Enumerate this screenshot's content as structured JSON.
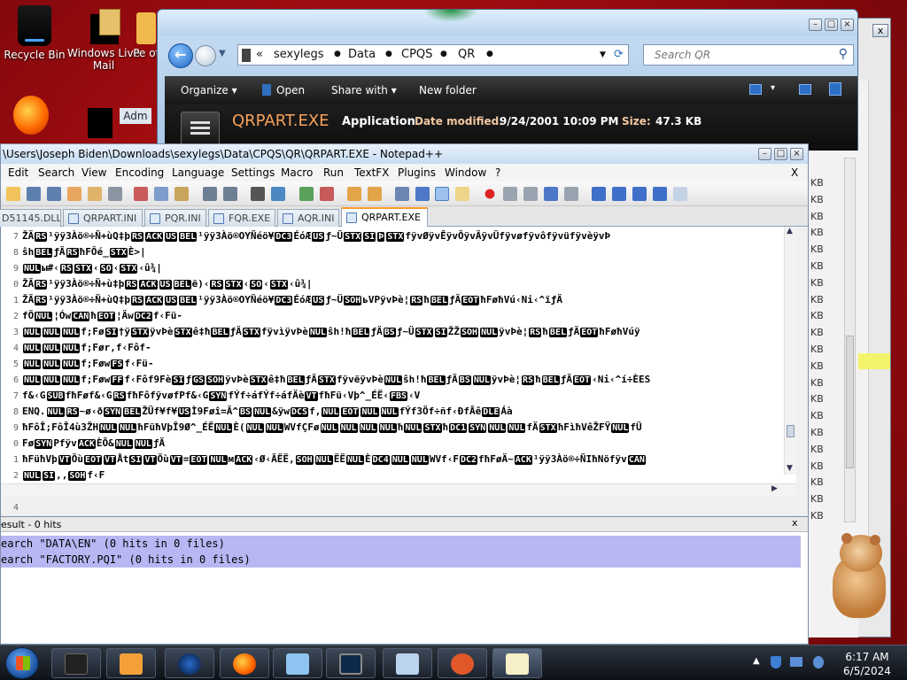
{
  "desktop": {
    "icons": [
      {
        "label": "Recycle Bin"
      },
      {
        "label": "Windows Live Mail"
      },
      {
        "label": "Pe of"
      },
      {
        "label": "Adm"
      }
    ]
  },
  "explorer": {
    "address": {
      "segments": [
        "sexylegs",
        "Data",
        "CPQS",
        "QR"
      ],
      "prefix": "«"
    },
    "search": {
      "placeholder": "Search QR"
    },
    "toolbar": {
      "organize": "Organize",
      "open": "Open",
      "share": "Share with",
      "new_folder": "New folder"
    },
    "details": {
      "filename": "QRPART.EXE",
      "type": "Application",
      "modified_label": "Date modified:",
      "modified_value": "9/24/2001 10:09 PM",
      "size_label": "Size:",
      "size_value": "47.3 KB"
    },
    "side_sizes": [
      "KB",
      "KB",
      "KB",
      "KB",
      "KB",
      "KB",
      "KB",
      "KB",
      "KB",
      "KB",
      "KB",
      "KB",
      "KB",
      "KB",
      "KB",
      "KB",
      "KB",
      "KB",
      "KB",
      "KB",
      "KB"
    ]
  },
  "npp": {
    "title": "\\Users\\Joseph Biden\\Downloads\\sexylegs\\Data\\CPQS\\QR\\QRPART.EXE - Notepad++",
    "close": "X",
    "menu": [
      "Edit",
      "Search",
      "View",
      "Encoding",
      "Language",
      "Settings",
      "Macro",
      "Run",
      "TextFX",
      "Plugins",
      "Window",
      "?"
    ],
    "tabs": [
      {
        "label": "D51145.DLL",
        "active": false
      },
      {
        "label": "QRPART.INI",
        "active": false
      },
      {
        "label": "PQR.INI",
        "active": false
      },
      {
        "label": "FQR.EXE",
        "active": false
      },
      {
        "label": "AQR.INI",
        "active": false
      },
      {
        "label": "QRPART.EXE",
        "active": true
      }
    ],
    "line_numbers": [
      "7",
      "8",
      "9",
      "0",
      "1",
      "2",
      "3",
      "4",
      "5",
      "6",
      "7",
      "8",
      "9",
      "0",
      "1",
      "2",
      "3",
      "4",
      "5"
    ],
    "lines": [
      [
        "ŽÄ",
        "RS",
        "¹ÿÿ3Àö®÷Ñ+ùQ‡þ",
        "RS",
        "ACK",
        "US",
        "BEL",
        "¹ÿÿ3Àö®OYÑéö¥",
        "DC3",
        "ÉóÆ",
        "US",
        "ƒ~Ü",
        "STX",
        "SI",
        "Þ",
        "STX",
        "fÿvØÿvÊÿvÖÿvÄÿvÜfÿvøfÿvôfÿvüfÿvèÿvÞ"
      ],
      [
        "ŝh",
        "BEL",
        "ƒÄ",
        "RS",
        "ħFÔé_",
        "STX",
        "È>|"
      ],
      [
        "NUL",
        "ы#‹",
        "RS",
        "STX",
        "‹",
        "SO",
        "‹",
        "STX",
        "‹û¾|"
      ],
      [
        "ŽÄ",
        "RS",
        "¹ÿÿ3Àö®÷Ñ+ù‡þ",
        "RS",
        "ACK",
        "US",
        "BEL",
        "ë)‹",
        "RS",
        "STX",
        "‹",
        "SO",
        "‹",
        "STX",
        "‹û¾|"
      ],
      [
        "ŽÄ",
        "RS",
        "¹ÿÿ3Àö®÷Ñ+ùQ‡þ",
        "RS",
        "ACK",
        "US",
        "BEL",
        "¹ÿÿ3Àö®OYÑéö¥",
        "DC3",
        "ÉóÆ",
        "US",
        "ƒ~Ü",
        "SOH",
        "ьVPÿvÞè¦",
        "RS",
        "ħ",
        "BEL",
        "ƒÄ",
        "EOT",
        "ħFøħVú‹Ni‹^ïƒÄ"
      ],
      [
        "fÖ",
        "NUL",
        "¦Ów",
        "CAN",
        "ħ",
        "EOT",
        "¦Äw",
        "DC2",
        "f‹Fü-"
      ],
      [
        "NUL",
        "NUL",
        "NUL",
        "f;Fø",
        "SI",
        "†ÿ",
        "STX",
        "ÿvÞè",
        "STX",
        "ê‡ħ",
        "BEL",
        "ƒÄ",
        "STX",
        "fÿvìÿvÞè",
        "NUL",
        "ŝh!ħ",
        "BEL",
        "ƒÄ",
        "BS",
        "ƒ~Ü",
        "STX",
        "SI",
        "ŽŽ",
        "SOH",
        "NUL",
        "ÿvÞè¦",
        "RS",
        "ħ",
        "BEL",
        "ƒÄ",
        "EOT",
        "ħFøħVúÿ"
      ],
      [
        "NUL",
        "NUL",
        "NUL",
        "f;Før,f‹Fôf-"
      ],
      [
        "NUL",
        "NUL",
        "NUL",
        "f;Føw",
        "FS",
        "f‹Fü-"
      ],
      [
        "NUL",
        "NUL",
        "NUL",
        "f;Føw",
        "FF",
        "f‹Fôf9Fè",
        "SI",
        "ƒ",
        "GS",
        "SOH",
        "ÿvÞè",
        "STX",
        "ê‡ħ",
        "BEL",
        "ƒÄ",
        "STX",
        "fÿvëÿvÞè",
        "NUL",
        "ŝh!ħ",
        "BEL",
        "ƒÄ",
        "BS",
        "NUL",
        "ÿvÞè¦",
        "RS",
        "ħ",
        "BEL",
        "ƒÄ",
        "EOT",
        "‹Ni‹^í÷ÈES"
      ],
      [
        "f&‹G",
        "SUB",
        "fħFøf&‹G",
        "RS",
        "fħFôfÿvøfPf&‹G",
        "SYN",
        "fÝf÷áfÝf÷áfÄè",
        "VT",
        "fħFü‹Vþ^_ÉË‹",
        "FBS",
        "‹V"
      ],
      [
        "ENQ.",
        "NUL",
        "RS",
        "~ø‹ð",
        "SYN",
        "BEL",
        "ŽÜf¥f¥",
        "US",
        "Ì9Føî=Ä^",
        "BS",
        "NUL",
        "&ÿw",
        "DCS",
        "f,",
        "NUL",
        "EOT",
        "NUL",
        "NUL",
        "fÝf3Öf÷ñf‹ÐfÂê",
        "DLE",
        "Áà"
      ],
      [
        "ħFôÎ;FôÎ4ù3ŽH",
        "NUL",
        "NUL",
        "ħFüħVþÎ9Ø^_ÉË",
        "NUL",
        "È(",
        "NUL",
        "NUL",
        "WVfÇFø",
        "NUL",
        "NUL",
        "NUL",
        "NUL",
        "ħ",
        "NUL",
        "STX",
        "ħ",
        "DC1",
        "SYN",
        "NUL",
        "NUL",
        "fÄ",
        "STX",
        "ħFìħVêŽFŸ",
        "NUL",
        "fÜ"
      ],
      [
        "Fø",
        "SYN",
        "Pfÿv",
        "ACK",
        "ÈÕ&",
        "NUL",
        "NUL",
        "ƒÄ"
      ],
      [
        "ħFüħVþ",
        "VT",
        "Öù",
        "EOT",
        "VT",
        "Åt",
        "SI",
        "VT",
        "Öù",
        "VT",
        "=",
        "EOT",
        "NUL",
        "м",
        "ACK",
        "‹Ø‹ÃËË,",
        "SOH",
        "NUL",
        "ËË",
        "NUL",
        "È",
        "DC4",
        "NUL",
        "NUL",
        "WVf‹F",
        "DC2",
        "fħFøÄ~",
        "ACK",
        "¹ÿÿ3Àö®÷ÑIħNöfÿv",
        "CAN"
      ],
      [
        "NUL",
        "SI",
        ",,",
        "SOH",
        "f‹F"
      ],
      [
        ""
      ],
      [
        ""
      ],
      [
        ""
      ]
    ],
    "results": {
      "title": "esult - 0 hits",
      "close": "x",
      "items": [
        "earch \"DATA\\EN\" (0 hits in 0 files)",
        "earch \"FACTORY.PQI\" (0 hits in 0 files)"
      ]
    }
  },
  "taskbar": {
    "clock_time": "6:17 AM",
    "clock_date": "6/5/2024"
  },
  "colors": {
    "desktop": "#b5121a",
    "npp_tab_accent": "#fa9a2a",
    "result_highlight": "#b7b7f4"
  }
}
